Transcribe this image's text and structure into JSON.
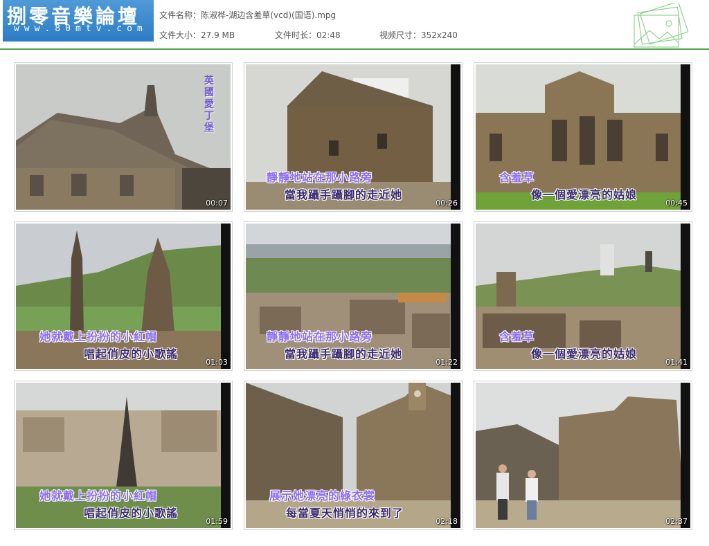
{
  "header": {
    "logo_text": "捌零音樂論壇",
    "logo_url": "www.80mtv.com",
    "file_name_label": "文件名称：",
    "file_name": "陈淑桦-湖边含羞草(vcd)(国语).mpg",
    "file_size_label": "文件大小：",
    "file_size": "27.9 MB",
    "duration_label": "文件时长：",
    "duration": "02:48",
    "resolution_label": "视频尺寸：",
    "resolution": "352x240"
  },
  "thumbnails": [
    {
      "time": "00:07",
      "line1": "",
      "line2": "",
      "side_title": "英國愛丁堡"
    },
    {
      "time": "00:26",
      "line1": "靜靜地站在那小路旁",
      "line2": "當我躡手躡腳的走近她",
      "side_title": ""
    },
    {
      "time": "00:45",
      "line1": "含羞草",
      "line2": "像一個愛漂亮的姑娘",
      "side_title": ""
    },
    {
      "time": "01:03",
      "line1": "她就戴上扮扮的小紅帽",
      "line2": "唱起俏皮的小歌謠",
      "side_title": ""
    },
    {
      "time": "01:22",
      "line1": "靜靜地站在那小路旁",
      "line2": "當我躡手躡腳的走近她",
      "side_title": ""
    },
    {
      "time": "01:41",
      "line1": "含羞草",
      "line2": "像一個愛漂亮的姑娘",
      "side_title": ""
    },
    {
      "time": "01:59",
      "line1": "她就戴上扮扮的小紅帽",
      "line2": "唱起俏皮的小歌謠",
      "side_title": ""
    },
    {
      "time": "02:18",
      "line1": "展示她漂亮的綠衣裳",
      "line2": "每當夏天悄悄的來到了",
      "side_title": ""
    },
    {
      "time": "02:37",
      "line1": "",
      "line2": "",
      "side_title": ""
    }
  ]
}
